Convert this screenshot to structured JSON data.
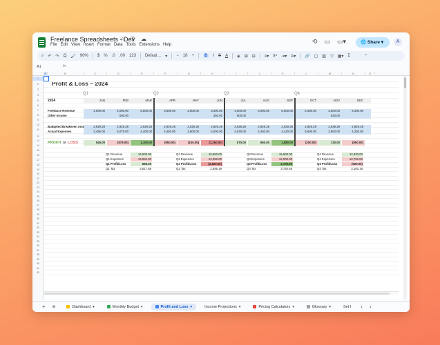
{
  "app": {
    "doc_title": "Freelance Spreadsheets - Dev",
    "title_icons": "☆ ⎘ ☁",
    "menu": [
      "File",
      "Edit",
      "View",
      "Insert",
      "Format",
      "Data",
      "Tools",
      "Extensions",
      "Help"
    ],
    "right_icons": [
      "⟲",
      "▭",
      "▭▾"
    ],
    "share_label": "Share",
    "avatar_initial": "A"
  },
  "toolbar": {
    "zoom": "90%",
    "currency": "$",
    "percent": "%",
    "decimal_dec": ".0",
    "decimal_inc": ".00",
    "number_format": "123",
    "font": "Defaul…",
    "font_size": "18",
    "bold": "B",
    "italic": "I",
    "strike": "S",
    "text_color": "A"
  },
  "formula_bar": {
    "cell_ref": "A1",
    "fx": "fx"
  },
  "columns": [
    "A",
    "B",
    "C",
    "D",
    "E",
    "F",
    "G",
    "H",
    "I",
    "J",
    "K",
    "L",
    "M",
    "N",
    "O"
  ],
  "rows": [
    "1",
    "2",
    "3",
    "4",
    "5",
    "6",
    "7",
    "8",
    "9",
    "10",
    "11",
    "12",
    "13",
    "14",
    "15",
    "16",
    "17",
    "18",
    "19",
    "20",
    "21",
    "22",
    "23",
    "24",
    "25",
    "26",
    "27",
    "28",
    "29",
    "30",
    "31",
    "32",
    "33",
    "34",
    "35",
    "36",
    "37",
    "38",
    "39",
    "40",
    "41",
    "42"
  ],
  "sheet": {
    "title": "Profit & Loss – 2024",
    "quarters": [
      "Q1",
      "Q2",
      "Q3",
      "Q4"
    ],
    "year_label": "2024",
    "months": [
      "JAN",
      "FEB",
      "MAR",
      "APR",
      "MAY",
      "JUN",
      "JUL",
      "AUG",
      "SEP",
      "OCT",
      "NOV",
      "DEC"
    ],
    "row_labels": {
      "revenue": "Freelance Revenue",
      "other": "Other Income",
      "breakeven": "Budgeted Breakeven Amt.",
      "expenses": "Actual Expenses",
      "profit": "PROFIT",
      "or": "or",
      "loss": "LOSS"
    },
    "revenue": [
      "4,000.00",
      "4,000.00",
      "5,500.00",
      "3,500.00",
      "3,500.00",
      "3,000.00",
      "4,000.00",
      "6,000.00",
      "6,000.00",
      "5,400.00",
      "3,600.00",
      "3,400.00"
    ],
    "other": [
      "",
      "500.00",
      "",
      "",
      "",
      "250.00",
      "600.00",
      "",
      "",
      "",
      "530.00",
      ""
    ],
    "breakeven": [
      "2,929.28",
      "2,929.28",
      "2,929.28",
      "2,929.28",
      "2,929.28",
      "2,929.28",
      "2,929.28",
      "2,929.28",
      "2,929.28",
      "2,929.28",
      "2,929.28",
      "2,929.28"
    ],
    "expenses": [
      "3,455.00",
      "5,079.00",
      "4,400.00",
      "4,450.00",
      "3,600.00",
      "5,000.00",
      "4,030.00",
      "4,450.00",
      "4,420.00",
      "5,600.00",
      "3,900.00",
      "4,250.00"
    ],
    "profit": [
      "545.00",
      "(579.00)",
      "1,100.00",
      "(950.00)",
      "(100.00)",
      "(1,250.00)",
      "570.00",
      "550.00",
      "1,580.00",
      "(200.00)",
      "130.00",
      "(850.00)"
    ],
    "profit_sign": [
      "pos",
      "neg",
      "pos-strong",
      "neg",
      "neg",
      "neg-strong",
      "pos",
      "pos",
      "pos-strong",
      "neg",
      "pos",
      "neg"
    ],
    "quarter_summaries": [
      {
        "rev_label": "Q1 Revenue",
        "rev": "14,500.00",
        "exp_label": "Q1 Expenses",
        "exp": "13,934.00",
        "pl_label": "Q1 Profit/Loss",
        "pl": "566.00",
        "pl_sign": "pos",
        "tax_label": "Q1 Tax",
        "tax": "3,517.68"
      },
      {
        "rev_label": "Q2 Revenue",
        "rev": "10,850.00",
        "exp_label": "Q2 Expenses",
        "exp": "13,050.00",
        "pl_label": "Q2 Profit/Loss",
        "pl": "(2,400.00)",
        "pl_sign": "neg-strong",
        "tax_label": "Q2 Tax",
        "tax": "2,556.19"
      },
      {
        "rev_label": "Q3 Revenue",
        "rev": "15,600.00",
        "exp_label": "Q3 Expenses",
        "exp": "12,900.00",
        "pl_label": "Q3 Profit/Loss",
        "pl": "2,700.00",
        "pl_sign": "pos-strong",
        "tax_label": "Q3 Tax",
        "tax": "3,792.68"
      },
      {
        "rev_label": "Q4 Revenue",
        "rev": "12,830.00",
        "exp_label": "Q4 Expenses",
        "exp": "13,750.00",
        "pl_label": "Q4 Profit/Loss",
        "pl": "(920.00)",
        "pl_sign": "neg",
        "tax_label": "Q4 Tax",
        "tax": "3,100.18"
      }
    ]
  },
  "tabs": [
    {
      "label": "Dashboard",
      "color": "#fbbc04"
    },
    {
      "label": "Monthly Budget",
      "color": "#34a853"
    },
    {
      "label": "Profit and Loss",
      "color": "#4285f4",
      "active": true
    },
    {
      "label": "Income Projections",
      "color": ""
    },
    {
      "label": "Pricing Calculators",
      "color": "#ea4335"
    },
    {
      "label": "Glossary",
      "color": "#9aa0a6"
    },
    {
      "label": "Set I",
      "color": ""
    }
  ],
  "tab_controls": {
    "add": "+",
    "list": "≡",
    "prev": "‹",
    "next": "›"
  },
  "colors": {
    "accent": "#0b57d0",
    "positive": "#d9ead3",
    "negative": "#f4cccc",
    "band": "#cfe2f3"
  }
}
